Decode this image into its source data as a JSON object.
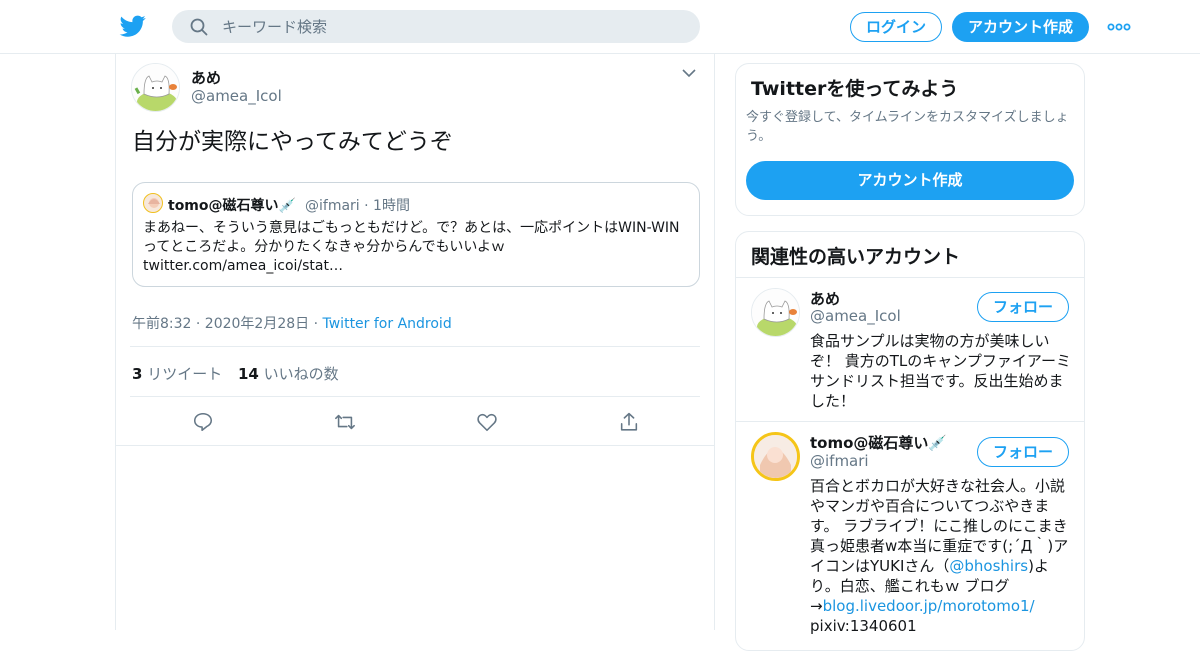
{
  "header": {
    "search_placeholder": "キーワード検索",
    "login_label": "ログイン",
    "signup_label": "アカウント作成"
  },
  "tweet": {
    "author_name": "あめ",
    "author_handle": "@amea_Icol",
    "text": "自分が実際にやってみてどうぞ",
    "quoted": {
      "author_name": "tomo@磁石尊い",
      "author_emoji": "💉",
      "author_handle": "@ifmari",
      "time": "1時間",
      "text": "まあねー、そういう意見はごもっともだけど。で？あとは、一応ポイントはWIN-WINってところだよ。分かりたくなきゃ分からんでもいいよｗ twitter.com/amea_icoi/stat…"
    },
    "timestamp": "午前8:32 · 2020年2月28日",
    "source": "Twitter for Android",
    "retweets_count": "3",
    "retweets_label": "リツイート",
    "likes_count": "14",
    "likes_label": "いいねの数"
  },
  "sidebar": {
    "signup_card": {
      "title": "Twitterを使ってみよう",
      "description": "今すぐ登録して、タイムラインをカスタマイズしましょう。",
      "button_label": "アカウント作成"
    },
    "relevant_accounts": {
      "title": "関連性の高いアカウント",
      "follow_label": "フォロー",
      "accounts": [
        {
          "name": "あめ",
          "handle": "@amea_Icol",
          "bio": "食品サンプルは実物の方が美味しいぞ！ 貴方のTLのキャンプファイアーミサンドリスト担当です。反出生始めました！"
        },
        {
          "name": "tomo@磁石尊い",
          "name_emoji": "💉",
          "handle": "@ifmari",
          "bio_part1": "百合とボカロが大好きな社会人。小説やマンガや百合についてつぶやきます。 ラブライブ！にこ推しのにこまき真っ姫患者w本当に重症です(;´Д｀)アイコンはYUKIさん（",
          "bio_mention": "@bhoshirs",
          "bio_part2": ")より。白恋、艦これもｗ ブログ→",
          "bio_link": "blog.livedoor.jp/morotomo1/",
          "bio_part3": " pixiv:1340601"
        }
      ]
    }
  },
  "colors": {
    "accent": "#1da1f2",
    "link": "#1b95e0",
    "secondary_text": "#657786",
    "border": "#e6ecf0"
  }
}
